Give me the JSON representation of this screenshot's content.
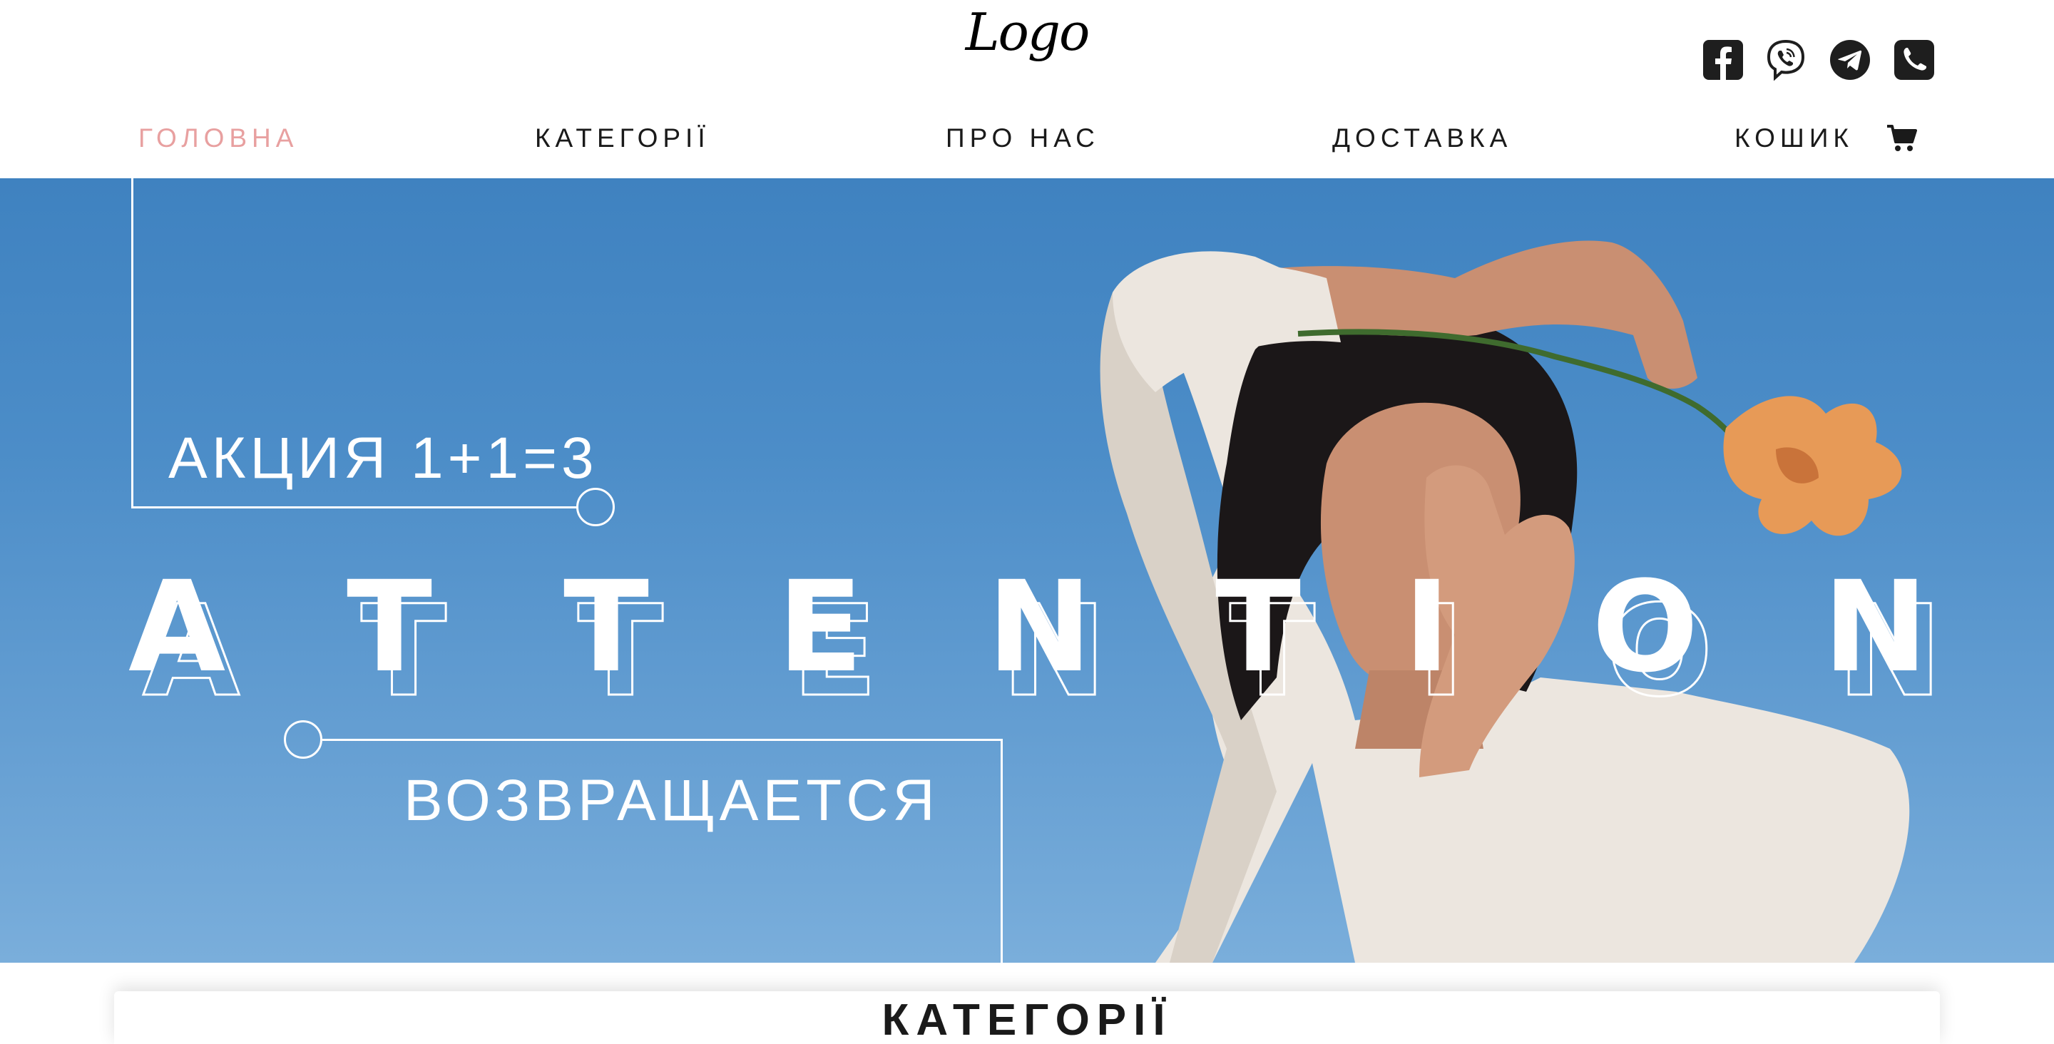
{
  "header": {
    "logo_text": "Logo",
    "social": [
      {
        "icon": "facebook-icon"
      },
      {
        "icon": "viber-icon"
      },
      {
        "icon": "telegram-icon"
      },
      {
        "icon": "phone-icon"
      }
    ],
    "nav": [
      {
        "label": "ГОЛОВНА",
        "active": true
      },
      {
        "label": "КАТЕГОРІЇ",
        "active": false
      },
      {
        "label": "ПРО НАС",
        "active": false
      },
      {
        "label": "ДОСТАВКА",
        "active": false
      },
      {
        "label": "КОШИК",
        "active": false
      }
    ],
    "cart_icon": "cart-icon"
  },
  "hero": {
    "promo_line": "АКЦИЯ 1+1=3",
    "headline_letters": [
      "A",
      "T",
      "T",
      "E",
      "N",
      "T",
      "I",
      "O",
      "N"
    ],
    "subline": "ВОЗВРАЩАЕТСЯ"
  },
  "categories": {
    "title": "КАТЕГОРІЇ"
  },
  "colors": {
    "active_nav": "#e8a0a0",
    "hero_sky": "#4c8dc8",
    "text": "#1a1a1a"
  }
}
